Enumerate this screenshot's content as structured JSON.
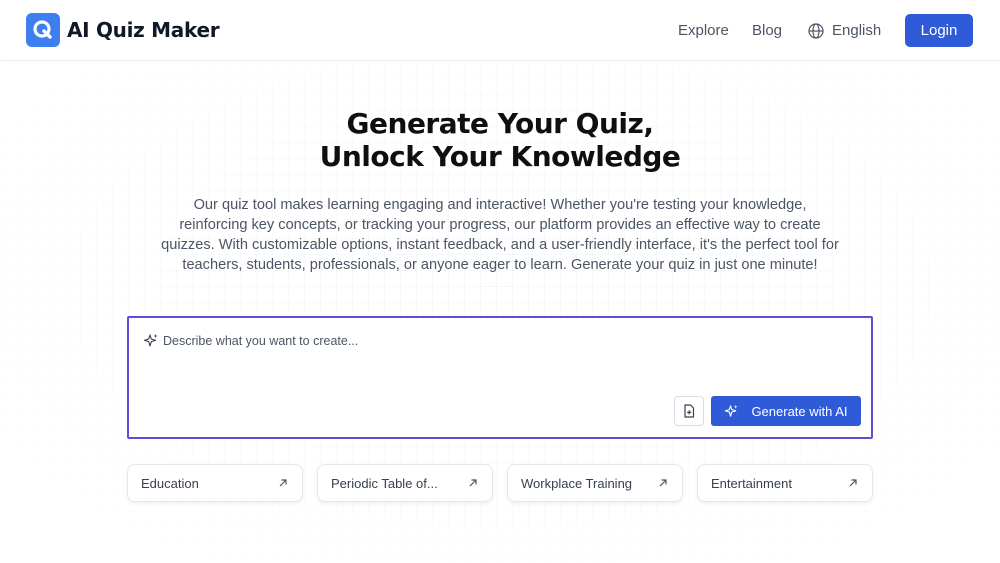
{
  "header": {
    "brand": "AI Quiz Maker",
    "nav": {
      "explore": "Explore",
      "blog": "Blog",
      "language": "English"
    },
    "login_label": "Login"
  },
  "hero": {
    "title_line1": "Generate Your Quiz,",
    "title_line2": "Unlock Your Knowledge",
    "description": "Our quiz tool makes learning engaging and interactive! Whether you're testing your knowledge, reinforcing key concepts, or tracking your progress, our platform provides an effective way to create quizzes. With customizable options, instant feedback, and a user-friendly interface, it's the perfect tool for teachers, students, professionals, or anyone eager to learn. Generate your quiz in just one minute!"
  },
  "prompt": {
    "placeholder": "Describe what you want to create...",
    "value": "",
    "generate_label": "Generate with AI"
  },
  "suggestions": [
    {
      "label": "Education",
      "icon": "arrow-up-right-icon"
    },
    {
      "label": "Periodic Table of...",
      "icon": "arrow-up-right-icon"
    },
    {
      "label": "Workplace Training",
      "icon": "arrow-up-right-icon"
    },
    {
      "label": "Entertainment",
      "icon": "arrow-up-right-icon"
    }
  ],
  "colors": {
    "primary": "#2f5bd8",
    "logo": "#3d7ef0",
    "prompt_border": "#5a4fd6"
  }
}
